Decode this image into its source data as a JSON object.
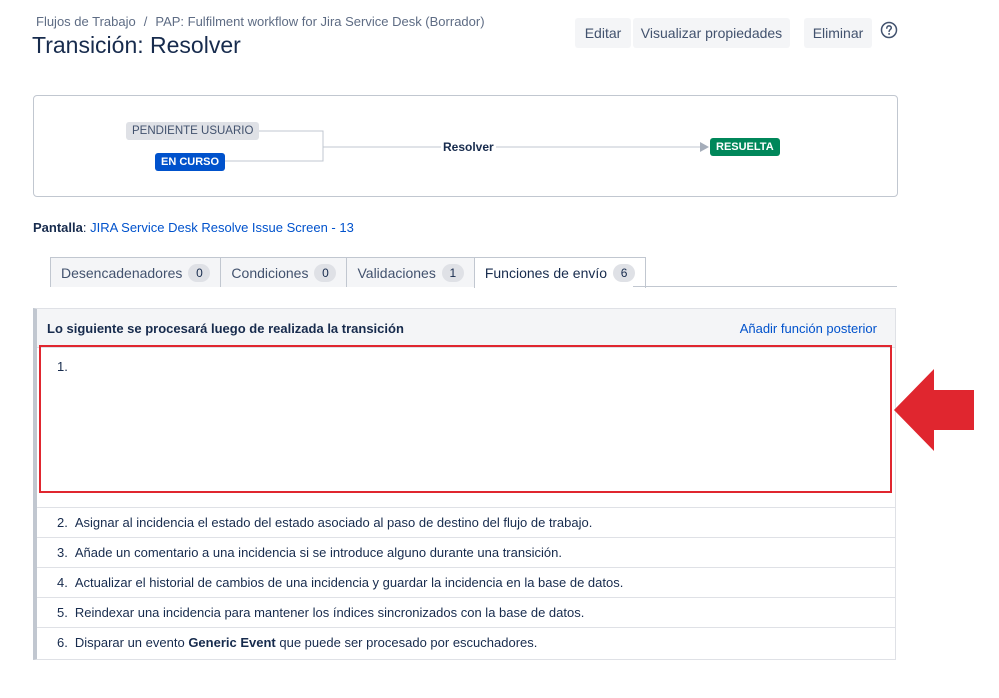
{
  "breadcrumb": {
    "items": [
      "Flujos de Trabajo",
      "PAP: Fulfilment workflow for Jira Service Desk (Borrador)"
    ],
    "separator": "/"
  },
  "page_title": "Transición: Resolver",
  "toolbar": {
    "edit": "Editar",
    "view_properties": "Visualizar propiedades",
    "delete": "Eliminar",
    "help_icon": "question-circle-icon"
  },
  "diagram": {
    "from_statuses": [
      "PENDIENTE USUARIO",
      "EN CURSO"
    ],
    "transition": "Resolver",
    "to_status": "RESUELTA"
  },
  "screen": {
    "label": "Pantalla",
    "value": "JIRA Service Desk Resolve Issue Screen - 13"
  },
  "tabs": [
    {
      "label": "Desencadenadores",
      "count": "0"
    },
    {
      "label": "Condiciones",
      "count": "0"
    },
    {
      "label": "Validaciones",
      "count": "1"
    },
    {
      "label": "Funciones de envío",
      "count": "6"
    }
  ],
  "panel": {
    "title": "Lo siguiente se procesará luego de realizada la transición",
    "action": "Añadir función posterior",
    "first_item_number": "1.",
    "items": [
      {
        "num": "2.",
        "text": "Asignar al incidencia el estado del estado asociado al paso de destino del flujo de trabajo."
      },
      {
        "num": "3.",
        "text": "Añade un comentario a una incidencia si se introduce alguno durante una transición."
      },
      {
        "num": "4.",
        "text": "Actualizar el historial de cambios de una incidencia y guardar la incidencia en la base de datos."
      },
      {
        "num": "5.",
        "text": "Reindexar una incidencia para mantener los índices sincronizados con la base de datos."
      }
    ],
    "last_item": {
      "num": "6.",
      "before": "Disparar un evento",
      "event": "Generic Event",
      "after": "que puede ser procesado por escuchadores."
    }
  },
  "colors": {
    "highlight": "#e0262f",
    "link": "#0052cc",
    "status_in_progress": "#0052cc",
    "status_done": "#00875a"
  }
}
